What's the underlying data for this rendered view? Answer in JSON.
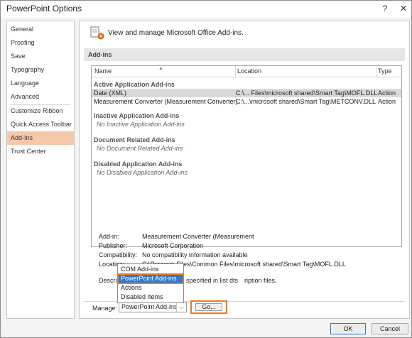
{
  "window": {
    "title": "PowerPoint Options",
    "help_glyph": "?",
    "close_glyph": "✕"
  },
  "sidebar": {
    "items": [
      {
        "label": "General"
      },
      {
        "label": "Proofing"
      },
      {
        "label": "Save"
      },
      {
        "label": "Typography"
      },
      {
        "label": "Language"
      },
      {
        "label": "Advanced"
      },
      {
        "label": "Customize Ribbon"
      },
      {
        "label": "Quick Access Toolbar"
      },
      {
        "label": "Add-Ins",
        "active": true
      },
      {
        "label": "Trust Center"
      }
    ]
  },
  "main": {
    "header_text": "View and manage Microsoft Office Add-ins.",
    "header_icon": "addins-gear-icon",
    "section_title": "Add-ins",
    "columns": {
      "name": "Name",
      "sort_glyph": "▲",
      "location": "Location",
      "type": "Type"
    },
    "groups": {
      "active": "Active Application Add-ins",
      "inactive": "Inactive Application Add-ins",
      "inactive_none": "No Inactive Application Add-ins",
      "document": "Document Related Add-ins",
      "document_none": "No Document Related Add-ins",
      "disabled": "Disabled Application Add-ins",
      "disabled_none": "No Disabled Application Add-ins"
    },
    "rows": [
      {
        "name": "Date (XML)",
        "location": "C:\\... Files\\microsoft shared\\Smart Tag\\MOFL.DLL",
        "type": "Action",
        "selected": true
      },
      {
        "name": "Measurement Converter (Measurement Converter)",
        "location": "C:\\...\\microsoft shared\\Smart Tag\\METCONV.DLL",
        "type": "Action"
      }
    ],
    "details": {
      "addin_label": "Add-in:",
      "addin_value": "Measurement Converter (Measurement",
      "publisher_label": "Publisher:",
      "publisher_value": "Microsoft Corporation",
      "compat_label": "Compatibility:",
      "compat_value": "No compatibility information available",
      "location_label": "Location:",
      "location_value": "C:\\Program Files\\Common Files\\microsoft shared\\Smart Tag\\MOFL.DLL",
      "description_label": "Descrip",
      "description_value_a": "specified in list dts",
      "description_value_b": "ription files."
    },
    "manage": {
      "label": "Manage:",
      "selected": "PowerPoint Add-ins",
      "arrow_glyph": "⌵",
      "go_label": "Go..."
    },
    "dropdown": {
      "options": [
        "COM Add-ins",
        "PowerPoint Add-ins",
        "Actions",
        "Disabled Items"
      ],
      "highlighted_index": 1
    }
  },
  "footer": {
    "ok_label": "OK",
    "cancel_label": "Cancel"
  },
  "colors": {
    "accent_orange": "#ee7a1f",
    "selection_blue": "#2b79d6",
    "sidebar_active": "#f4c8a8"
  }
}
